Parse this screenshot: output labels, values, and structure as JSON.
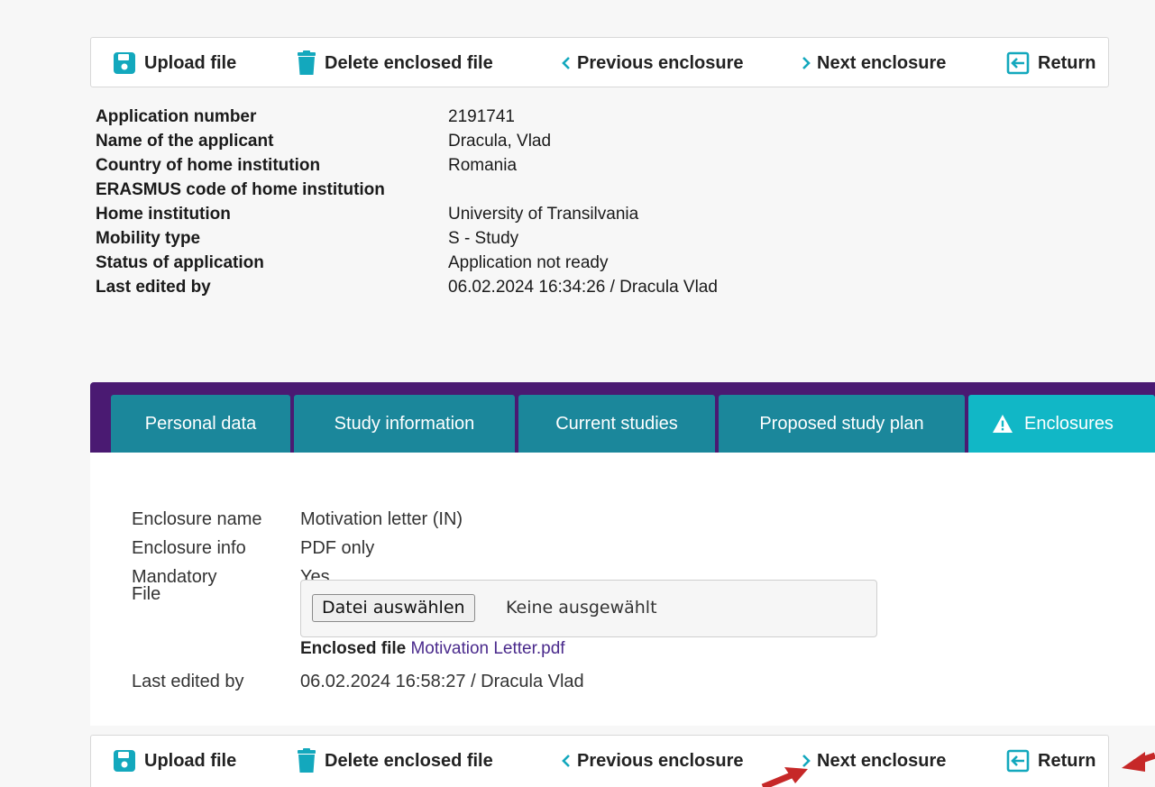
{
  "toolbar": {
    "upload": "Upload file",
    "delete": "Delete enclosed file",
    "previous": "Previous enclosure",
    "next": "Next enclosure",
    "return": "Return"
  },
  "application": {
    "rows": [
      {
        "label": "Application number",
        "value": "2191741"
      },
      {
        "label": "Name of the applicant",
        "value": "Dracula, Vlad"
      },
      {
        "label": "Country of home institution",
        "value": "Romania"
      },
      {
        "label": "ERASMUS code of home institution",
        "value": ""
      },
      {
        "label": "Home institution",
        "value": "University of Transilvania"
      },
      {
        "label": "Mobility type",
        "value": "S - Study"
      },
      {
        "label": "Status of application",
        "value": "Application not ready"
      },
      {
        "label": "Last edited by",
        "value": "06.02.2024 16:34:26 / Dracula Vlad"
      }
    ]
  },
  "tabs": [
    {
      "label": "Personal data"
    },
    {
      "label": "Study information"
    },
    {
      "label": "Current studies"
    },
    {
      "label": "Proposed study plan"
    },
    {
      "label": "Enclosures",
      "icon": "warning-icon",
      "active": true
    }
  ],
  "enclosure": {
    "name_label": "Enclosure name",
    "name_value": "Motivation letter (IN)",
    "info_label": "Enclosure info",
    "info_value": "PDF only",
    "mandatory_label": "Mandatory",
    "mandatory_value": "Yes",
    "file_label": "File",
    "choose_button": "Datei auswählen",
    "no_file": "Keine ausgewählt",
    "enclosed_label": "Enclosed file",
    "enclosed_link": "Motivation Letter.pdf",
    "last_edited_label": "Last edited by",
    "last_edited_value": "06.02.2024 16:58:27 / Dracula Vlad"
  },
  "colors": {
    "brand_purple": "#4a1a72",
    "tab_teal": "#1b879b",
    "tab_active": "#11b7c6",
    "icon_teal": "#13a8bd",
    "link": "#4a2a8c",
    "annotation_red": "#c62828"
  }
}
